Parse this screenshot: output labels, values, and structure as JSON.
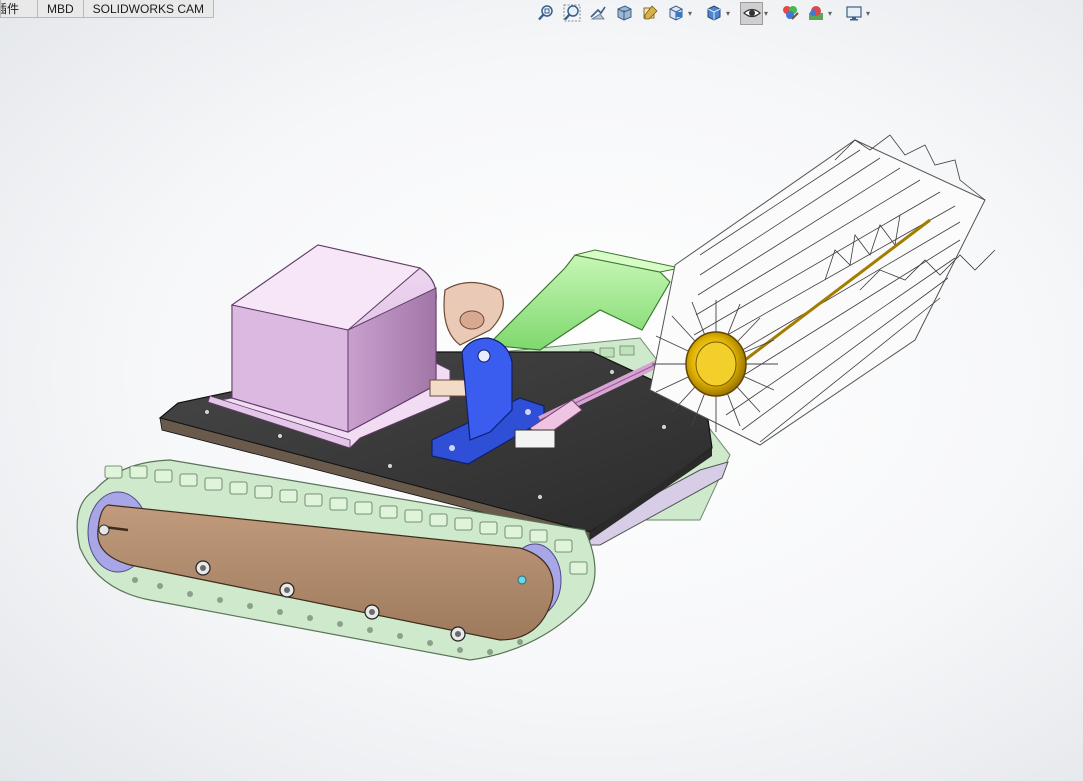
{
  "command_tabs": [
    {
      "label": "插件",
      "state": "partially-visible"
    },
    {
      "label": "MBD"
    },
    {
      "label": "SOLIDWORKS CAM"
    }
  ],
  "heads_up_toolbar": [
    {
      "icon": "zoom-to-fit-icon"
    },
    {
      "icon": "zoom-to-area-icon"
    },
    {
      "icon": "previous-view-icon"
    },
    {
      "icon": "section-view-icon"
    },
    {
      "icon": "dynamic-annotation-views-icon"
    },
    {
      "icon": "view-orientation-icon",
      "dropdown": true
    },
    {
      "icon": "display-style-icon",
      "dropdown": true
    },
    {
      "icon": "hide-show-items-icon",
      "dropdown": true,
      "active": true
    },
    {
      "icon": "edit-appearance-icon"
    },
    {
      "icon": "apply-scene-icon",
      "dropdown": true
    },
    {
      "icon": "view-settings-icon",
      "dropdown": true
    }
  ],
  "model": {
    "components": [
      {
        "name": "control-box",
        "color": "#e7c6ea"
      },
      {
        "name": "chassis-plate",
        "color": "#3b3b3b"
      },
      {
        "name": "crawler-track",
        "color": "#cfe9cc"
      },
      {
        "name": "track-side-plate",
        "color": "#b08a6c"
      },
      {
        "name": "motor-mount-bracket",
        "color": "#2f4fd6"
      },
      {
        "name": "brush-arm",
        "color": "#a8ef98"
      },
      {
        "name": "rolling-brush",
        "color": "#ffffff"
      },
      {
        "name": "brush-hub",
        "color": "#e0b400"
      },
      {
        "name": "drive-shaft",
        "color": "#d7a2d4"
      },
      {
        "name": "universal-joint",
        "color": "#eac9b6"
      }
    ]
  }
}
